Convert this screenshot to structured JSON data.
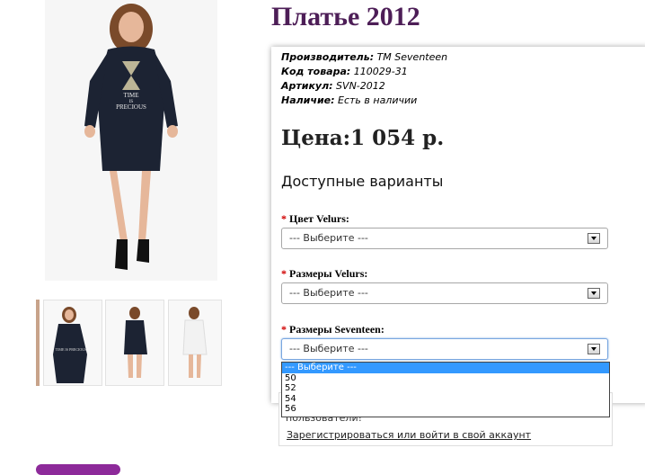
{
  "product": {
    "title": "Платье 2012",
    "main_image_print": {
      "line1": "TIME",
      "line2": "IS",
      "line3": "PRECIOUS"
    },
    "thumb_image_print": "TIME IS PRECIOUS"
  },
  "info": {
    "manufacturer_label": "Производитель:",
    "manufacturer_value": " TM Seventeen",
    "code_label": "Код товара:",
    "code_value": " 110029-31",
    "sku_label": "Артикул:",
    "sku_value": " SVN-2012",
    "availability_label": "Наличие:",
    "availability_value": " Есть в наличии"
  },
  "price": "Цена:1 054 р.",
  "variants_heading": "Доступные варианты",
  "options": [
    {
      "required_mark": "*",
      "label": "Цвет Velurs:",
      "selected": "--- Выберите ---"
    },
    {
      "required_mark": "*",
      "label": "Размеры Velurs:",
      "selected": "--- Выберите ---"
    },
    {
      "required_mark": "*",
      "label": "Размеры Seventeen:",
      "selected": "--- Выберите ---"
    }
  ],
  "dropdown_options": [
    "--- Выберите ---",
    "50",
    "52",
    "54",
    "56"
  ],
  "login": {
    "text": "пользователи!",
    "link": "Зарегистрироваться или войти в свой аккаунт"
  },
  "colors": {
    "title": "#4d1e57",
    "required": "#d00000",
    "dropdown_highlight": "#3399ff",
    "accent_tab": "#8d2a9a"
  }
}
